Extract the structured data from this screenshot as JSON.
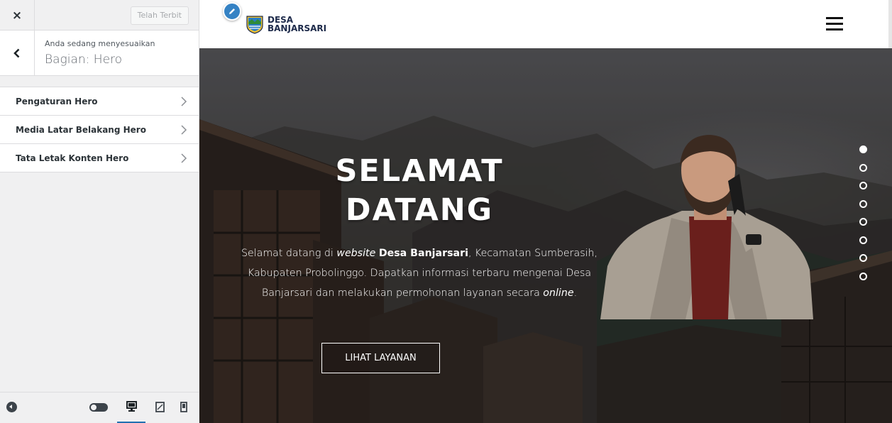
{
  "customizer": {
    "close_label": "×",
    "publish_label": "Telah Terbit",
    "customizing_label": "Anda sedang menyesuaikan",
    "section_title": "Bagian: Hero",
    "panels": [
      {
        "label": "Pengaturan Hero"
      },
      {
        "label": "Media Latar Belakang Hero"
      },
      {
        "label": "Tata Letak Konten Hero"
      }
    ],
    "active_device": "desktop"
  },
  "site": {
    "name_line1": "DESA",
    "name_line2": "BANJARSARI"
  },
  "hero": {
    "title_line1": "SELAMAT",
    "title_line2": "DATANG",
    "text": {
      "p1": "Selamat datang di ",
      "em1": "website",
      "p2": " ",
      "strong": "Desa Banjarsari",
      "p3": ", Kecamatan Sumberasih, Kabupaten Probolinggo. Dapatkan informasi terbaru mengenai Desa Banjarsari dan melakukan permohonan layanan secara ",
      "em2": "online",
      "p4": "."
    },
    "button_label": "LIHAT LAYANAN",
    "slides_total": 8,
    "active_slide": 1
  },
  "colors": {
    "accent": "#2271b1",
    "edit_shortcut": "#3582c4",
    "site_name": "#1d2a4a"
  },
  "icons": {
    "close": "close-icon",
    "back": "chevron-left-icon",
    "panel_arrow": "chevron-right-icon",
    "edit": "pencil-icon",
    "menu": "hamburger-menu-icon"
  }
}
